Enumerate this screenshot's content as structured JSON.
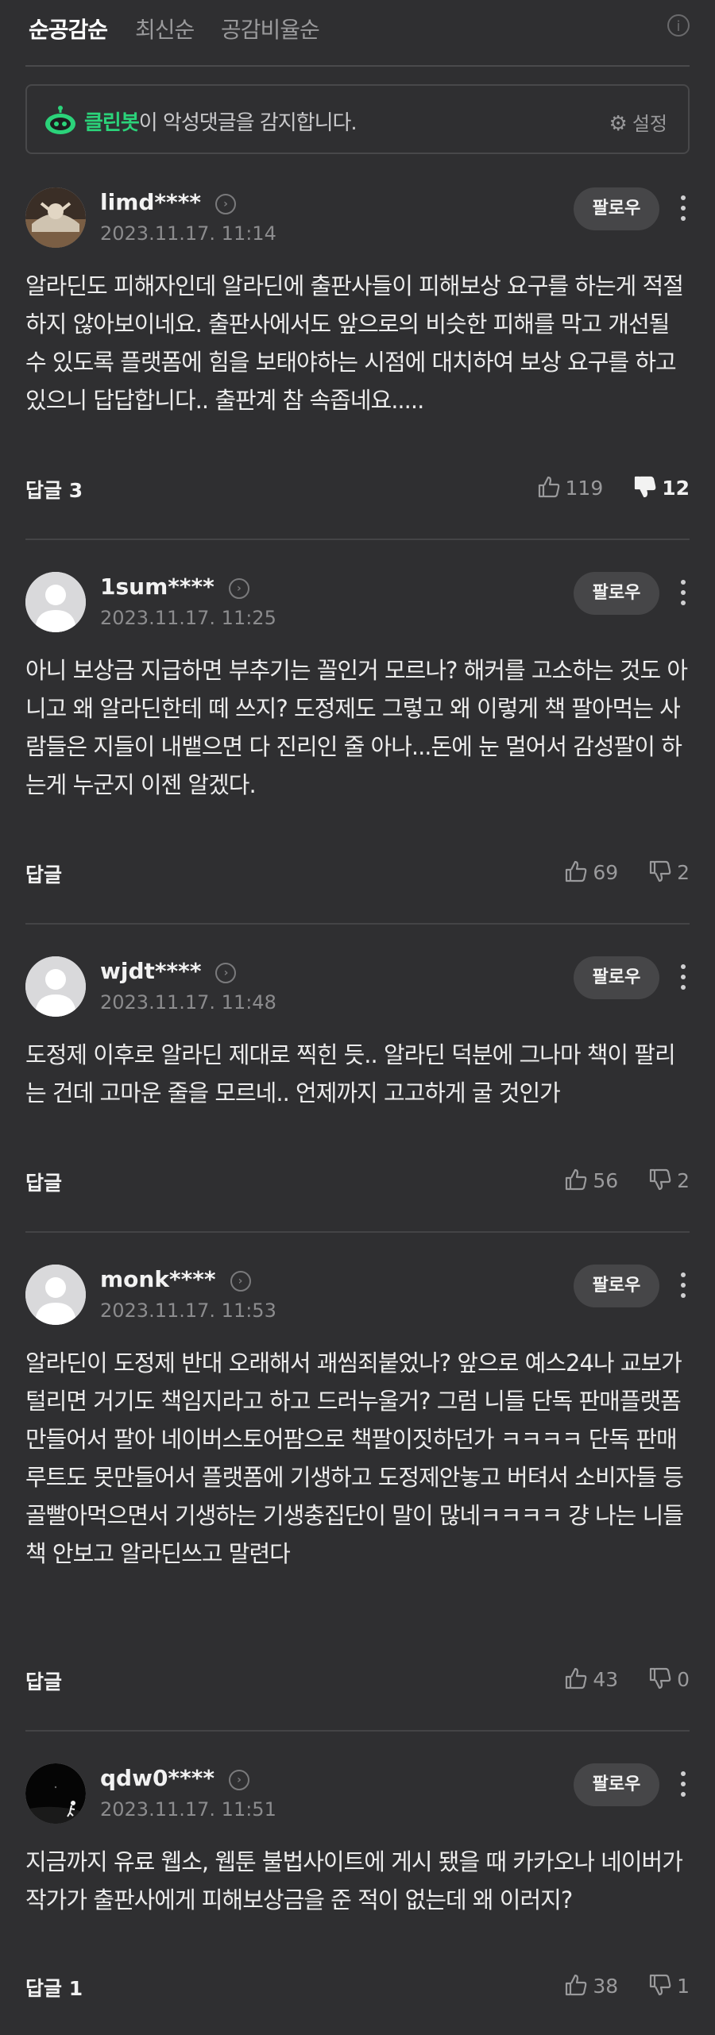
{
  "tabs": {
    "t1": "순공감순",
    "t2": "최신순",
    "t3": "공감비율순"
  },
  "cleanbot": {
    "name": "클린봇",
    "text": "이 악성댓글을 감지합니다.",
    "settings": "설정"
  },
  "follow_label": "팔로우",
  "comments": [
    {
      "user": "limd****",
      "date": "2023.11.17. 11:14",
      "text": "알라딘도 피해자인데 알라딘에 출판사들이 피해보상 요구를 하는게 적절하지 않아보이네요. 출판사에서도 앞으로의 비슷한 피해를 막고 개선될 수 있도록 플랫폼에 힘을 보태야하는 시점에 대치하여 보상 요구를 하고 있으니 답답합니다.. 출판계 참 속좁네요.....",
      "reply": "답글 3",
      "likes": "119",
      "dislikes": "12"
    },
    {
      "user": "1sum****",
      "date": "2023.11.17. 11:25",
      "text": "아니 보상금 지급하면 부추기는 꼴인거 모르나? 해커를 고소하는 것도 아니고 왜 알라딘한테 떼 쓰지? 도정제도 그렇고 왜 이렇게 책 팔아먹는 사람들은 지들이 내뱉으면 다 진리인 줄 아나...돈에 눈 멀어서 감성팔이 하는게 누군지 이젠 알겠다.",
      "reply": "답글",
      "likes": "69",
      "dislikes": "2"
    },
    {
      "user": "wjdt****",
      "date": "2023.11.17. 11:48",
      "text": "도정제 이후로 알라딘 제대로 찍힌 듯.. 알라딘 덕분에 그나마 책이 팔리는 건데 고마운 줄을 모르네.. 언제까지 고고하게 굴 것인가",
      "reply": "답글",
      "likes": "56",
      "dislikes": "2"
    },
    {
      "user": "monk****",
      "date": "2023.11.17. 11:53",
      "text": "알라딘이 도정제 반대 오래해서 괘씸죄붙었나? 앞으로 예스24나 교보가 털리면 거기도 책임지라고 하고 드러누울거? 그럼 니들 단독 판매플랫폼만들어서 팔아 네이버스토어팜으로 책팔이짓하던가 ㅋㅋㅋㅋ 단독 판매루트도 못만들어서 플랫폼에 기생하고 도정제안놓고 버텨서 소비자들 등골빨아먹으면서 기생하는 기생충집단이 말이 많네ㅋㅋㅋㅋ 걍 나는 니들 책 안보고 알라딘쓰고 말련다",
      "reply": "답글",
      "likes": "43",
      "dislikes": "0"
    },
    {
      "user": "qdw0****",
      "date": "2023.11.17. 11:51",
      "text": "지금까지 유료 웹소, 웹툰 불법사이트에 게시 됐을 때 카카오나 네이버가 작가가 출판사에게 피해보상금을 준 적이 없는데 왜 이러지?",
      "reply": "답글 1",
      "likes": "38",
      "dislikes": "1"
    }
  ]
}
